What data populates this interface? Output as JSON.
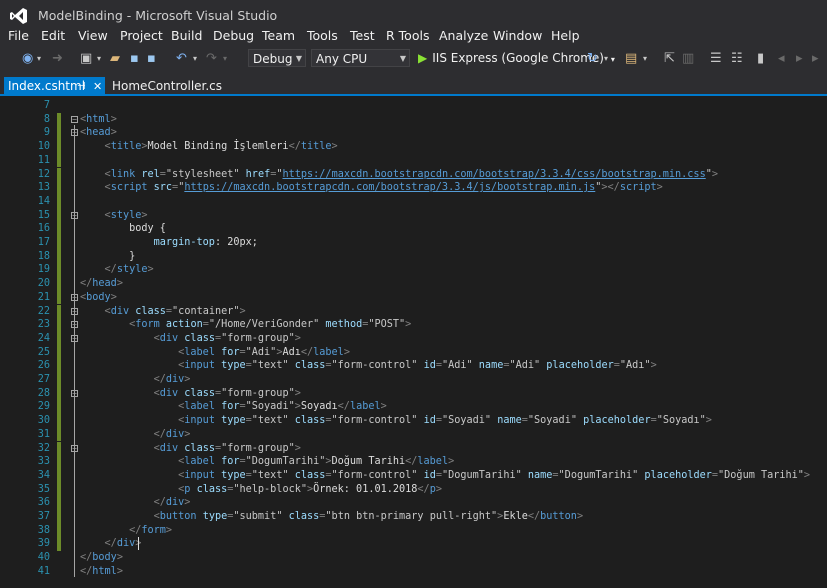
{
  "window": {
    "title": "ModelBinding - Microsoft Visual Studio"
  },
  "menu": [
    "File",
    "Edit",
    "View",
    "Project",
    "Build",
    "Debug",
    "Team",
    "Tools",
    "Test",
    "R Tools",
    "Analyze",
    "Window",
    "Help"
  ],
  "toolbar": {
    "config": "Debug",
    "platform": "Any CPU",
    "run_target": "IIS Express (Google Chrome)"
  },
  "tabs": [
    {
      "label": "Index.cshtml",
      "active": true
    },
    {
      "label": "HomeController.cs",
      "active": false
    }
  ],
  "editor": {
    "lines": [
      {
        "n": "7",
        "indent": 0,
        "tokens": []
      },
      {
        "n": "8",
        "indent": 0,
        "tokens": [
          [
            "p",
            "<"
          ],
          [
            "t",
            "html"
          ],
          [
            "p",
            ">"
          ]
        ]
      },
      {
        "n": "9",
        "indent": 0,
        "tokens": [
          [
            "p",
            "<"
          ],
          [
            "t",
            "head"
          ],
          [
            "p",
            ">"
          ]
        ]
      },
      {
        "n": "10",
        "indent": 4,
        "tokens": [
          [
            "p",
            "<"
          ],
          [
            "t",
            "title"
          ],
          [
            "p",
            ">"
          ],
          [
            "tx",
            "Model Binding İşlemleri"
          ],
          [
            "p",
            "</"
          ],
          [
            "t",
            "title"
          ],
          [
            "p",
            ">"
          ]
        ]
      },
      {
        "n": "11",
        "indent": 0,
        "tokens": []
      },
      {
        "n": "12",
        "indent": 4,
        "tokens": [
          [
            "p",
            "<"
          ],
          [
            "t",
            "link"
          ],
          [
            "tx",
            " "
          ],
          [
            "a",
            "rel"
          ],
          [
            "p",
            "="
          ],
          [
            "v",
            "\"stylesheet\""
          ],
          [
            "tx",
            " "
          ],
          [
            "a",
            "href"
          ],
          [
            "p",
            "="
          ],
          [
            "v",
            "\""
          ],
          [
            "u",
            "https://maxcdn.bootstrapcdn.com/bootstrap/3.3.4/css/bootstrap.min.css"
          ],
          [
            "v",
            "\""
          ],
          [
            "p",
            ">"
          ]
        ]
      },
      {
        "n": "13",
        "indent": 4,
        "tokens": [
          [
            "p",
            "<"
          ],
          [
            "t",
            "script"
          ],
          [
            "tx",
            " "
          ],
          [
            "a",
            "src"
          ],
          [
            "p",
            "="
          ],
          [
            "v",
            "\""
          ],
          [
            "u",
            "https://maxcdn.bootstrapcdn.com/bootstrap/3.3.4/js/bootstrap.min.js"
          ],
          [
            "v",
            "\""
          ],
          [
            "p",
            "></"
          ],
          [
            "t",
            "script"
          ],
          [
            "p",
            ">"
          ]
        ]
      },
      {
        "n": "14",
        "indent": 0,
        "tokens": []
      },
      {
        "n": "15",
        "indent": 4,
        "tokens": [
          [
            "p",
            "<"
          ],
          [
            "t",
            "style"
          ],
          [
            "p",
            ">"
          ]
        ]
      },
      {
        "n": "16",
        "indent": 8,
        "tokens": [
          [
            "tx",
            "body {"
          ]
        ]
      },
      {
        "n": "17",
        "indent": 12,
        "tokens": [
          [
            "a",
            "margin-top"
          ],
          [
            "tx",
            ": 20px;"
          ]
        ]
      },
      {
        "n": "18",
        "indent": 8,
        "tokens": [
          [
            "tx",
            "}"
          ]
        ]
      },
      {
        "n": "19",
        "indent": 4,
        "tokens": [
          [
            "p",
            "</"
          ],
          [
            "t",
            "style"
          ],
          [
            "p",
            ">"
          ]
        ]
      },
      {
        "n": "20",
        "indent": 0,
        "tokens": [
          [
            "p",
            "</"
          ],
          [
            "t",
            "head"
          ],
          [
            "p",
            ">"
          ]
        ]
      },
      {
        "n": "21",
        "indent": 0,
        "tokens": [
          [
            "p",
            "<"
          ],
          [
            "t",
            "body"
          ],
          [
            "p",
            ">"
          ]
        ]
      },
      {
        "n": "22",
        "indent": 4,
        "tokens": [
          [
            "p",
            "<"
          ],
          [
            "t",
            "div"
          ],
          [
            "tx",
            " "
          ],
          [
            "a",
            "class"
          ],
          [
            "p",
            "="
          ],
          [
            "v",
            "\"container\""
          ],
          [
            "p",
            ">"
          ]
        ]
      },
      {
        "n": "23",
        "indent": 8,
        "tokens": [
          [
            "p",
            "<"
          ],
          [
            "t",
            "form"
          ],
          [
            "tx",
            " "
          ],
          [
            "a",
            "action"
          ],
          [
            "p",
            "="
          ],
          [
            "v",
            "\"/Home/VeriGonder\""
          ],
          [
            "tx",
            " "
          ],
          [
            "a",
            "method"
          ],
          [
            "p",
            "="
          ],
          [
            "v",
            "\"POST\""
          ],
          [
            "p",
            ">"
          ]
        ]
      },
      {
        "n": "24",
        "indent": 12,
        "tokens": [
          [
            "p",
            "<"
          ],
          [
            "t",
            "div"
          ],
          [
            "tx",
            " "
          ],
          [
            "a",
            "class"
          ],
          [
            "p",
            "="
          ],
          [
            "v",
            "\"form-group\""
          ],
          [
            "p",
            ">"
          ]
        ]
      },
      {
        "n": "25",
        "indent": 16,
        "tokens": [
          [
            "p",
            "<"
          ],
          [
            "t",
            "label"
          ],
          [
            "tx",
            " "
          ],
          [
            "a",
            "for"
          ],
          [
            "p",
            "="
          ],
          [
            "v",
            "\"Adi\""
          ],
          [
            "p",
            ">"
          ],
          [
            "tx",
            "Adı"
          ],
          [
            "p",
            "</"
          ],
          [
            "t",
            "label"
          ],
          [
            "p",
            ">"
          ]
        ]
      },
      {
        "n": "26",
        "indent": 16,
        "tokens": [
          [
            "p",
            "<"
          ],
          [
            "t",
            "input"
          ],
          [
            "tx",
            " "
          ],
          [
            "a",
            "type"
          ],
          [
            "p",
            "="
          ],
          [
            "v",
            "\"text\""
          ],
          [
            "tx",
            " "
          ],
          [
            "a",
            "class"
          ],
          [
            "p",
            "="
          ],
          [
            "v",
            "\"form-control\""
          ],
          [
            "tx",
            " "
          ],
          [
            "a",
            "id"
          ],
          [
            "p",
            "="
          ],
          [
            "v",
            "\"Adi\""
          ],
          [
            "tx",
            " "
          ],
          [
            "a",
            "name"
          ],
          [
            "p",
            "="
          ],
          [
            "v",
            "\"Adi\""
          ],
          [
            "tx",
            " "
          ],
          [
            "a",
            "placeholder"
          ],
          [
            "p",
            "="
          ],
          [
            "v",
            "\"Adı\""
          ],
          [
            "p",
            ">"
          ]
        ]
      },
      {
        "n": "27",
        "indent": 12,
        "tokens": [
          [
            "p",
            "</"
          ],
          [
            "t",
            "div"
          ],
          [
            "p",
            ">"
          ]
        ]
      },
      {
        "n": "28",
        "indent": 12,
        "tokens": [
          [
            "p",
            "<"
          ],
          [
            "t",
            "div"
          ],
          [
            "tx",
            " "
          ],
          [
            "a",
            "class"
          ],
          [
            "p",
            "="
          ],
          [
            "v",
            "\"form-group\""
          ],
          [
            "p",
            ">"
          ]
        ]
      },
      {
        "n": "29",
        "indent": 16,
        "tokens": [
          [
            "p",
            "<"
          ],
          [
            "t",
            "label"
          ],
          [
            "tx",
            " "
          ],
          [
            "a",
            "for"
          ],
          [
            "p",
            "="
          ],
          [
            "v",
            "\"Soyadi\""
          ],
          [
            "p",
            ">"
          ],
          [
            "tx",
            "Soyadı"
          ],
          [
            "p",
            "</"
          ],
          [
            "t",
            "label"
          ],
          [
            "p",
            ">"
          ]
        ]
      },
      {
        "n": "30",
        "indent": 16,
        "tokens": [
          [
            "p",
            "<"
          ],
          [
            "t",
            "input"
          ],
          [
            "tx",
            " "
          ],
          [
            "a",
            "type"
          ],
          [
            "p",
            "="
          ],
          [
            "v",
            "\"text\""
          ],
          [
            "tx",
            " "
          ],
          [
            "a",
            "class"
          ],
          [
            "p",
            "="
          ],
          [
            "v",
            "\"form-control\""
          ],
          [
            "tx",
            " "
          ],
          [
            "a",
            "id"
          ],
          [
            "p",
            "="
          ],
          [
            "v",
            "\"Soyadi\""
          ],
          [
            "tx",
            " "
          ],
          [
            "a",
            "name"
          ],
          [
            "p",
            "="
          ],
          [
            "v",
            "\"Soyadi\""
          ],
          [
            "tx",
            " "
          ],
          [
            "a",
            "placeholder"
          ],
          [
            "p",
            "="
          ],
          [
            "v",
            "\"Soyadı\""
          ],
          [
            "p",
            ">"
          ]
        ]
      },
      {
        "n": "31",
        "indent": 12,
        "tokens": [
          [
            "p",
            "</"
          ],
          [
            "t",
            "div"
          ],
          [
            "p",
            ">"
          ]
        ]
      },
      {
        "n": "32",
        "indent": 12,
        "tokens": [
          [
            "p",
            "<"
          ],
          [
            "t",
            "div"
          ],
          [
            "tx",
            " "
          ],
          [
            "a",
            "class"
          ],
          [
            "p",
            "="
          ],
          [
            "v",
            "\"form-group\""
          ],
          [
            "p",
            ">"
          ]
        ]
      },
      {
        "n": "33",
        "indent": 16,
        "tokens": [
          [
            "p",
            "<"
          ],
          [
            "t",
            "label"
          ],
          [
            "tx",
            " "
          ],
          [
            "a",
            "for"
          ],
          [
            "p",
            "="
          ],
          [
            "v",
            "\"DogumTarihi\""
          ],
          [
            "p",
            ">"
          ],
          [
            "tx",
            "Doğum Tarihi"
          ],
          [
            "p",
            "</"
          ],
          [
            "t",
            "label"
          ],
          [
            "p",
            ">"
          ]
        ]
      },
      {
        "n": "34",
        "indent": 16,
        "tokens": [
          [
            "p",
            "<"
          ],
          [
            "t",
            "input"
          ],
          [
            "tx",
            " "
          ],
          [
            "a",
            "type"
          ],
          [
            "p",
            "="
          ],
          [
            "v",
            "\"text\""
          ],
          [
            "tx",
            " "
          ],
          [
            "a",
            "class"
          ],
          [
            "p",
            "="
          ],
          [
            "v",
            "\"form-control\""
          ],
          [
            "tx",
            " "
          ],
          [
            "a",
            "id"
          ],
          [
            "p",
            "="
          ],
          [
            "v",
            "\"DogumTarihi\""
          ],
          [
            "tx",
            " "
          ],
          [
            "a",
            "name"
          ],
          [
            "p",
            "="
          ],
          [
            "v",
            "\"DogumTarihi\""
          ],
          [
            "tx",
            " "
          ],
          [
            "a",
            "placeholder"
          ],
          [
            "p",
            "="
          ],
          [
            "v",
            "\"Doğum Tarihi\""
          ],
          [
            "p",
            ">"
          ]
        ]
      },
      {
        "n": "35",
        "indent": 16,
        "tokens": [
          [
            "p",
            "<"
          ],
          [
            "t",
            "p"
          ],
          [
            "tx",
            " "
          ],
          [
            "a",
            "class"
          ],
          [
            "p",
            "="
          ],
          [
            "v",
            "\"help-block\""
          ],
          [
            "p",
            ">"
          ],
          [
            "tx",
            "Örnek: 01.01.2018"
          ],
          [
            "p",
            "</"
          ],
          [
            "t",
            "p"
          ],
          [
            "p",
            ">"
          ]
        ]
      },
      {
        "n": "36",
        "indent": 12,
        "tokens": [
          [
            "p",
            "</"
          ],
          [
            "t",
            "div"
          ],
          [
            "p",
            ">"
          ]
        ]
      },
      {
        "n": "37",
        "indent": 12,
        "tokens": [
          [
            "p",
            "<"
          ],
          [
            "t",
            "button"
          ],
          [
            "tx",
            " "
          ],
          [
            "a",
            "type"
          ],
          [
            "p",
            "="
          ],
          [
            "v",
            "\"submit\""
          ],
          [
            "tx",
            " "
          ],
          [
            "a",
            "class"
          ],
          [
            "p",
            "="
          ],
          [
            "v",
            "\"btn btn-primary pull-right\""
          ],
          [
            "p",
            ">"
          ],
          [
            "tx",
            "Ekle"
          ],
          [
            "p",
            "</"
          ],
          [
            "t",
            "button"
          ],
          [
            "p",
            ">"
          ]
        ]
      },
      {
        "n": "38",
        "indent": 8,
        "tokens": [
          [
            "p",
            "</"
          ],
          [
            "t",
            "form"
          ],
          [
            "p",
            ">"
          ]
        ]
      },
      {
        "n": "39",
        "indent": 4,
        "tokens": [
          [
            "p",
            "</"
          ],
          [
            "t",
            "div"
          ],
          [
            "p",
            ">"
          ]
        ]
      },
      {
        "n": "40",
        "indent": 0,
        "tokens": [
          [
            "p",
            "</"
          ],
          [
            "t",
            "body"
          ],
          [
            "p",
            ">"
          ]
        ]
      },
      {
        "n": "41",
        "indent": 0,
        "tokens": [
          [
            "p",
            "</"
          ],
          [
            "t",
            "html"
          ],
          [
            "p",
            ">"
          ]
        ]
      }
    ]
  },
  "colors": {
    "accent": "#007acc",
    "tag": "#569cd6",
    "attr": "#9cdcfe",
    "line_number": "#2b91af"
  }
}
